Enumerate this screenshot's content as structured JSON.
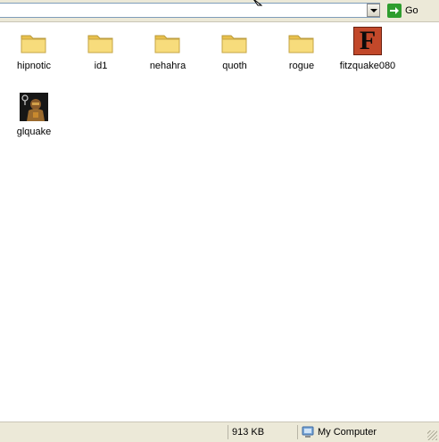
{
  "address_bar": {
    "go_label": "Go"
  },
  "items": [
    {
      "label": "hipnotic",
      "icon": "folder-icon"
    },
    {
      "label": "id1",
      "icon": "folder-icon"
    },
    {
      "label": "nehahra",
      "icon": "folder-icon"
    },
    {
      "label": "quoth",
      "icon": "folder-icon"
    },
    {
      "label": "rogue",
      "icon": "folder-icon"
    },
    {
      "label": "fitzquake080",
      "icon": "fitzquake-app-icon",
      "icon_letter": "F"
    },
    {
      "label": "glquake",
      "icon": "glquake-app-icon"
    }
  ],
  "status_bar": {
    "size": "913 KB",
    "zone": "My Computer"
  },
  "colors": {
    "chrome": "#ece9d8",
    "folder": "#f5d66e",
    "go_green": "#2e9d2e",
    "fitz_red": "#c2482a"
  }
}
